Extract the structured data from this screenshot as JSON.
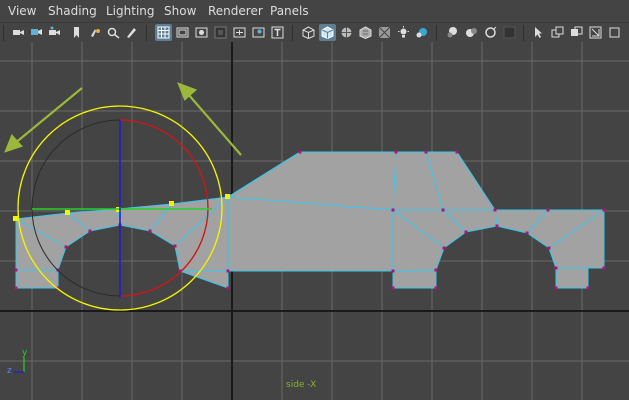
{
  "menubar": {
    "items": [
      {
        "id": "view",
        "label": "View"
      },
      {
        "id": "shading",
        "label": "Shading"
      },
      {
        "id": "lighting",
        "label": "Lighting"
      },
      {
        "id": "show",
        "label": "Show"
      },
      {
        "id": "renderer",
        "label": "Renderer"
      },
      {
        "id": "panels",
        "label": "Panels"
      }
    ]
  },
  "toolbar": {
    "icons": [
      "select-camera-icon",
      "camera-attributes-icon",
      "bookmark-icon",
      "image-plane-icon",
      "two-d-pan-zoom-icon",
      "grease-pencil-icon",
      "grid-icon",
      "film-gate-icon",
      "resolution-gate-icon",
      "gate-mask-icon",
      "field-chart-icon",
      "safe-action-icon",
      "wireframe-icon",
      "smooth-shade-icon",
      "wireframe-on-shaded-icon",
      "textured-icon",
      "use-all-lights-icon",
      "shadows-icon",
      "ambient-occlusion-icon",
      "motion-blur-icon",
      "anti-aliasing-icon",
      "depth-of-field-icon",
      "isolate-select-icon",
      "xray-icon",
      "xray-joints-icon",
      "backface-culling-icon",
      "panel-layout-icon"
    ]
  },
  "viewport": {
    "camera_label": "side -X",
    "axis_y_label": "y",
    "axis_z_label": "z",
    "colors": {
      "background": "#444444",
      "grid": "#6a6a6a",
      "grid_axis": "#1a1a1a",
      "mesh_fill": "#a2a2a2",
      "mesh_edge": "#35c8ee",
      "vertex": "#b0127a",
      "selected_vertex": "#f4f400",
      "manip_outer": "#f4f400",
      "manip_x_ring": "#cc1818",
      "manip_y_axis": "#1b1bd6",
      "manip_z_line": "#28d028",
      "arrow": "#9cb83a"
    }
  }
}
